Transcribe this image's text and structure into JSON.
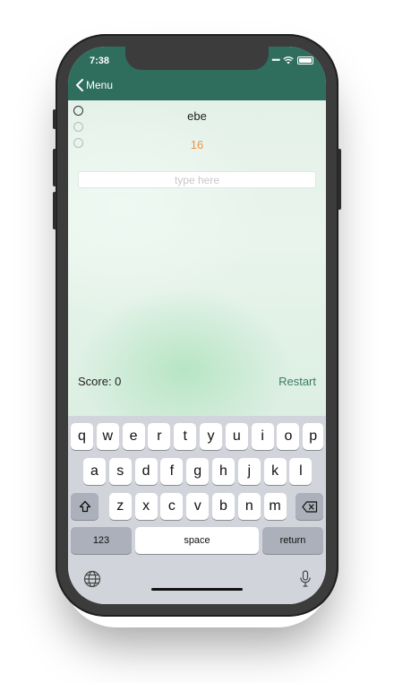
{
  "status_bar": {
    "time": "7:38"
  },
  "nav": {
    "back_label": "Menu"
  },
  "quiz": {
    "word": "ebe",
    "number": "16",
    "options_count": 3,
    "selected_option": 0
  },
  "input": {
    "placeholder": "type here",
    "value": ""
  },
  "footer": {
    "score_label": "Score: 0",
    "restart_label": "Restart"
  },
  "keyboard": {
    "row1": [
      "q",
      "w",
      "e",
      "r",
      "t",
      "y",
      "u",
      "i",
      "o",
      "p"
    ],
    "row2": [
      "a",
      "s",
      "d",
      "f",
      "g",
      "h",
      "j",
      "k",
      "l"
    ],
    "row3": [
      "z",
      "x",
      "c",
      "v",
      "b",
      "n",
      "m"
    ],
    "numbers_label": "123",
    "space_label": "space",
    "return_label": "return",
    "shift_icon": "shift-icon",
    "delete_icon": "delete-icon",
    "globe_icon": "globe-icon",
    "mic_icon": "microphone-icon"
  },
  "colors": {
    "header": "#2f6e5d",
    "accent": "#3b7c67",
    "number": "#e89549"
  }
}
